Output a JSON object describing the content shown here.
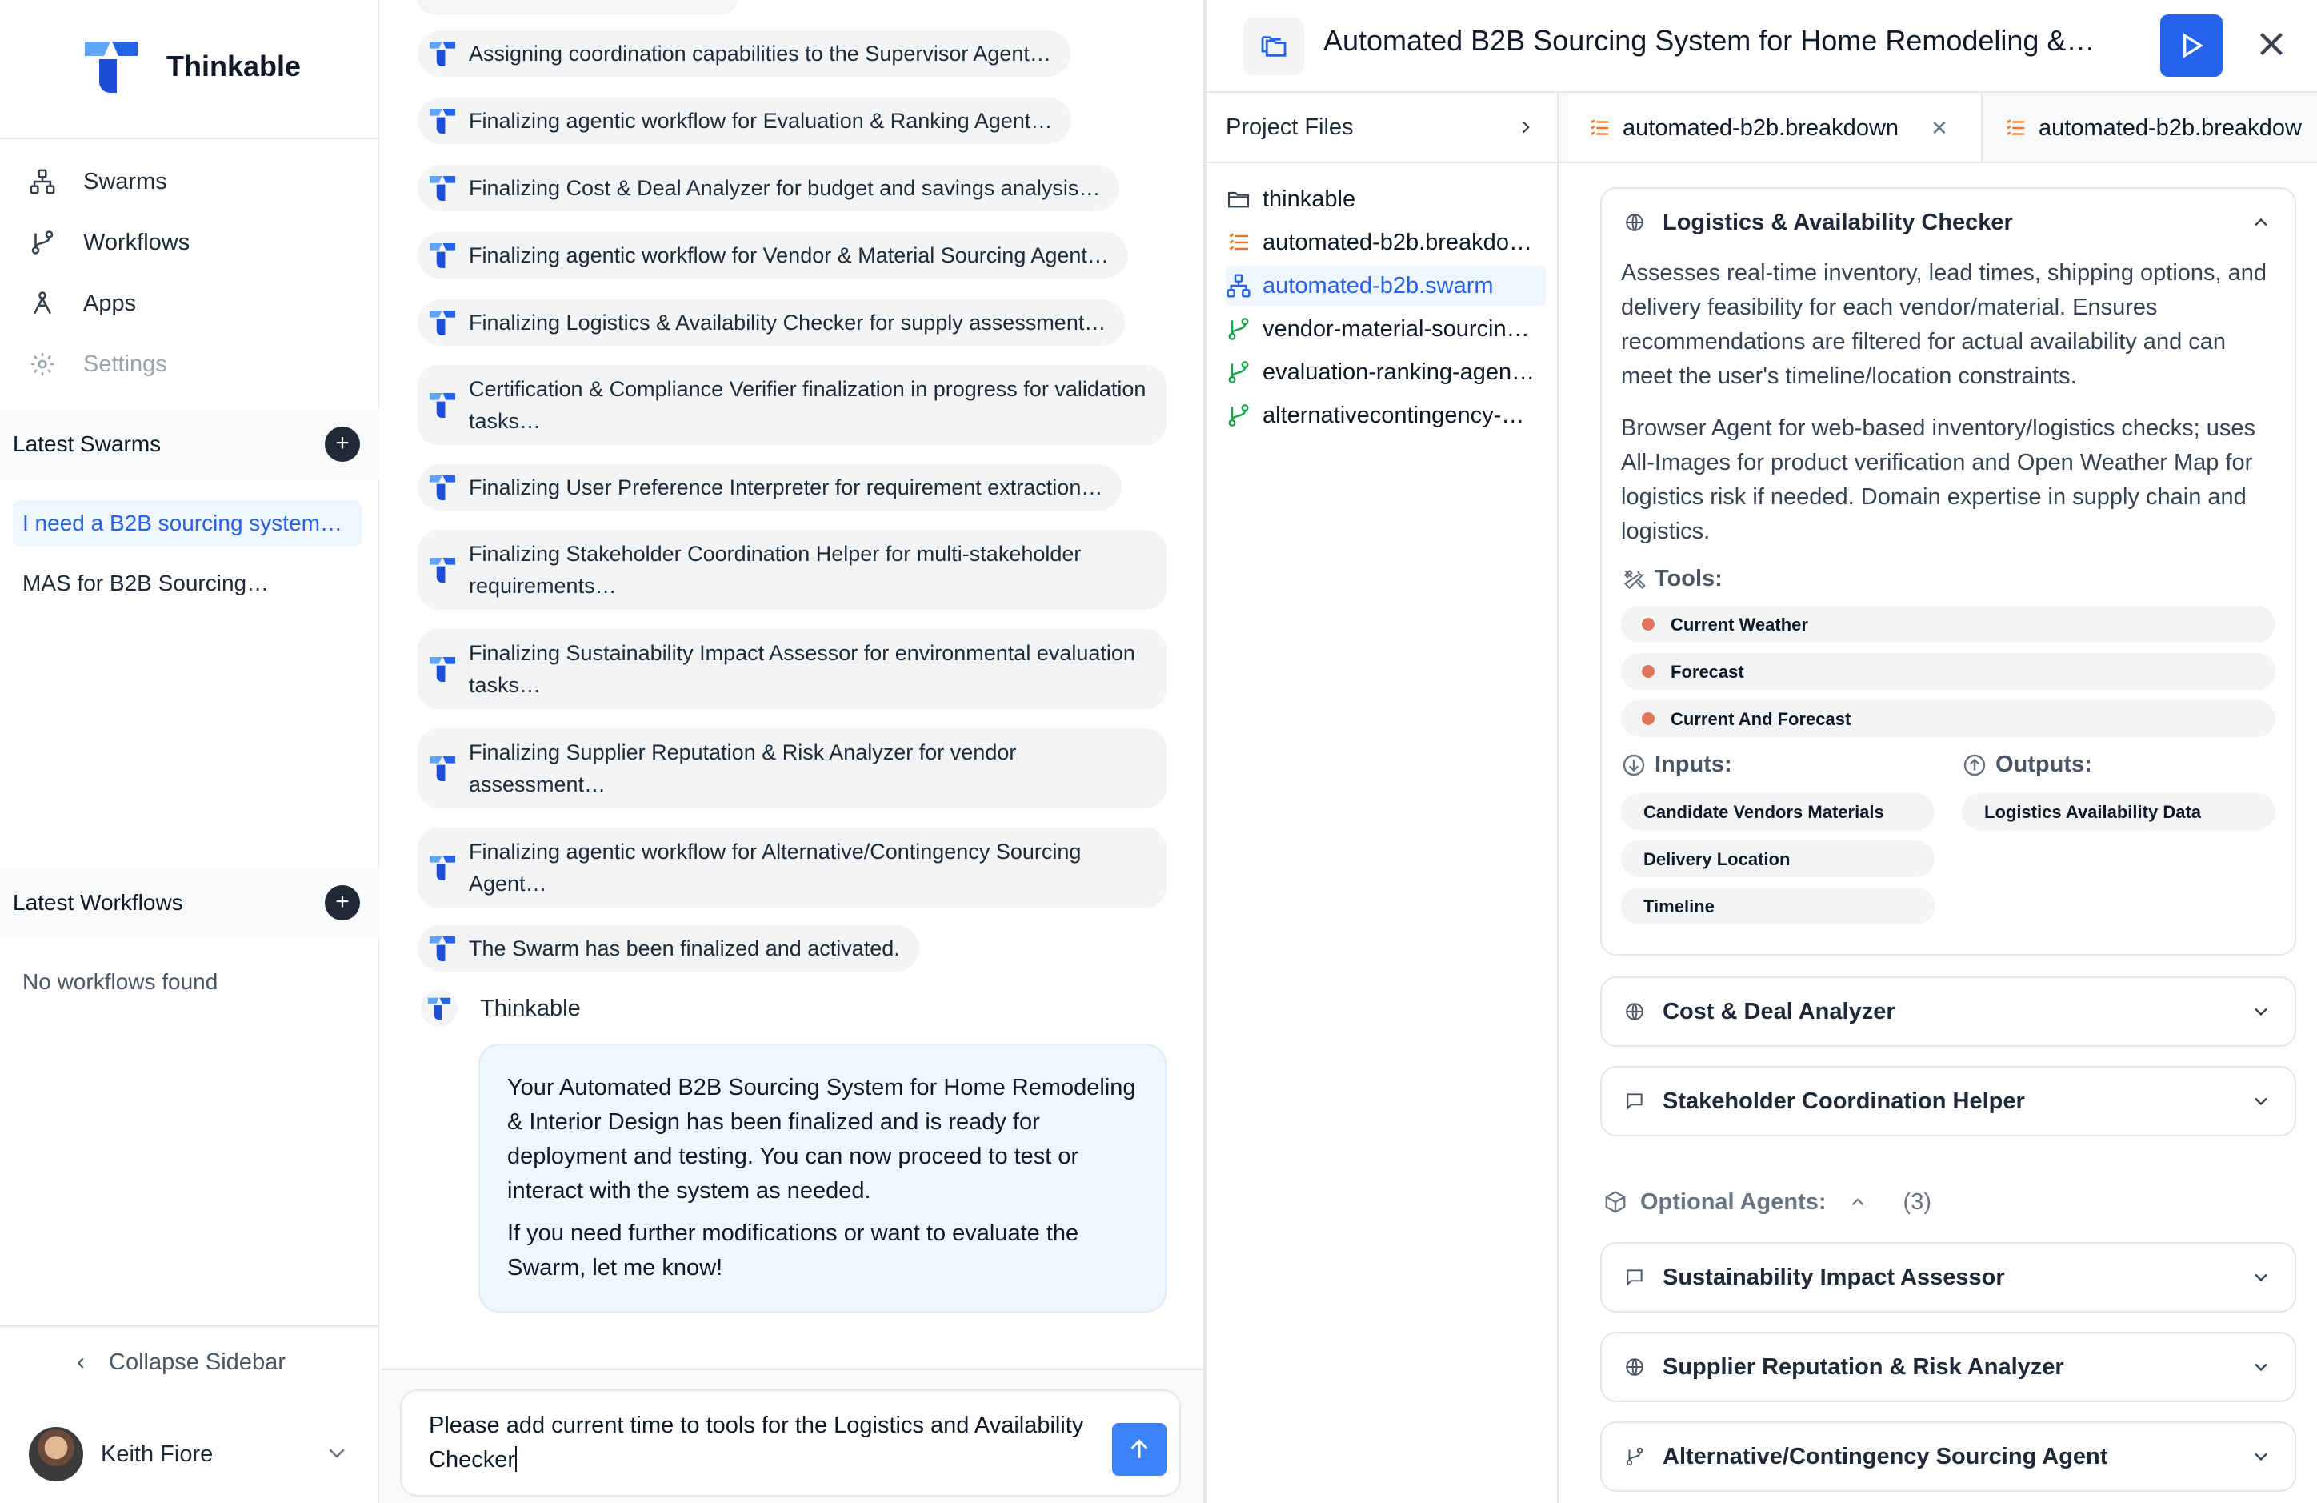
{
  "sidebar": {
    "brand": "Thinkable",
    "nav": [
      {
        "label": "Swarms",
        "icon": "swarms-icon"
      },
      {
        "label": "Workflows",
        "icon": "workflows-icon"
      },
      {
        "label": "Apps",
        "icon": "apps-icon"
      },
      {
        "label": "Settings",
        "icon": "settings-icon"
      }
    ],
    "latest_swarms": {
      "title": "Latest Swarms",
      "items": [
        "I need a B2B sourcing system…",
        "MAS for B2B Sourcing…"
      ]
    },
    "latest_workflows": {
      "title": "Latest Workflows",
      "empty": "No workflows found"
    },
    "collapse_label": "Collapse Sidebar",
    "user": {
      "name": "Keith Fiore"
    }
  },
  "chat": {
    "messages": [
      "Assigning coordination capabilities to the Supervisor Agent…",
      "Finalizing agentic workflow for Evaluation & Ranking Agent…",
      "Finalizing Cost & Deal Analyzer for budget and savings analysis…",
      "Finalizing agentic workflow for Vendor & Material Sourcing Agent…",
      "Finalizing Logistics & Availability Checker for supply assessment…",
      "Certification & Compliance Verifier finalization in progress for validation tasks…",
      "Finalizing User Preference Interpreter for requirement extraction…",
      "Finalizing Stakeholder Coordination Helper for multi-stakeholder requirements…",
      "Finalizing Sustainability Impact Assessor for environmental evaluation tasks…",
      "Finalizing Supplier Reputation & Risk Analyzer for vendor assessment…",
      "Finalizing agentic workflow for Alternative/Contingency Sourcing Agent…",
      "The Swarm has been finalized and activated."
    ],
    "assistant_name": "Thinkable",
    "reply": [
      "Your Automated B2B Sourcing System for Home Remodeling & Interior Design has been finalized and is ready for deployment and testing. You can now proceed to test or interact with the system as needed.",
      "If you need further modifications or want to evaluate the Swarm, let me know!"
    ],
    "composer_text": "Please add current time to tools for the Logistics and Availability Checker"
  },
  "panel": {
    "title": "Automated B2B Sourcing System for Home Remodeling &…",
    "files_title": "Project Files",
    "files": [
      {
        "name": "thinkable",
        "icon": "folder-icon"
      },
      {
        "name": "automated-b2b.breakdo…",
        "icon": "list-icon"
      },
      {
        "name": "automated-b2b.swarm",
        "icon": "swarm-file-icon"
      },
      {
        "name": "vendor-material-sourcin…",
        "icon": "workflow-file-icon"
      },
      {
        "name": "evaluation-ranking-agen…",
        "icon": "workflow-file-icon"
      },
      {
        "name": "alternativecontingency-…",
        "icon": "workflow-file-icon"
      }
    ],
    "tabs": [
      "automated-b2b.breakdown",
      "automated-b2b.breakdow"
    ],
    "expanded_agent": {
      "name": "Logistics & Availability Checker",
      "description": "Assesses real-time inventory, lead times, shipping options, and delivery feasibility for each vendor/material. Ensures recommendations are filtered for actual availability and can meet the user's timeline/location constraints.",
      "details": "Browser Agent for web-based inventory/logistics checks; uses All-Images for product verification and Open Weather Map for logistics risk if needed. Domain expertise in supply chain and logistics.",
      "tools_label": "Tools:",
      "tools": [
        "Current Weather",
        "Forecast",
        "Current And Forecast"
      ],
      "inputs_label": "Inputs:",
      "inputs": [
        "Candidate Vendors Materials",
        "Delivery Location",
        "Timeline"
      ],
      "outputs_label": "Outputs:",
      "outputs": [
        "Logistics Availability Data"
      ]
    },
    "collapsed_agents": [
      "Cost & Deal Analyzer",
      "Stakeholder Coordination Helper"
    ],
    "optional_label": "Optional Agents:",
    "optional_count": "(3)",
    "optional_agents": [
      "Sustainability Impact Assessor",
      "Supplier Reputation & Risk Analyzer",
      "Alternative/Contingency Sourcing Agent"
    ],
    "colors": {
      "accent": "#2563eb",
      "tool_dot": "#e0775b",
      "breakdown_icon": "#f97316",
      "workflow_icon": "#16a34a"
    }
  }
}
